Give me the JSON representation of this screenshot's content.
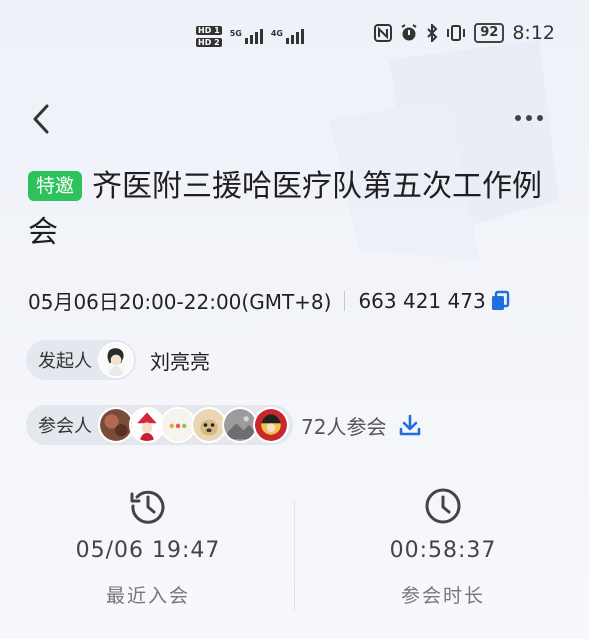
{
  "status_bar": {
    "sim1_badge": "HD 1",
    "sim2_badge": "HD 2",
    "net1": "5G",
    "net2": "4G",
    "battery": "92",
    "time": "8:12"
  },
  "meeting": {
    "badge": "特邀",
    "title": "齐医附三援哈医疗队第五次工作例会",
    "datetime": "05月06日20:00-22:00(GMT+8)",
    "meeting_id": "663 421 473"
  },
  "host": {
    "label": "发起人",
    "name": "刘亮亮"
  },
  "participants": {
    "label": "参会人",
    "count": "72人参会"
  },
  "stats": {
    "recent_join": {
      "value": "05/06 19:47",
      "label": "最近入会"
    },
    "duration": {
      "value": "00:58:37",
      "label": "参会时长"
    }
  },
  "colors": {
    "badge_green": "#2ec25c",
    "accent_blue": "#1f6fe0"
  }
}
